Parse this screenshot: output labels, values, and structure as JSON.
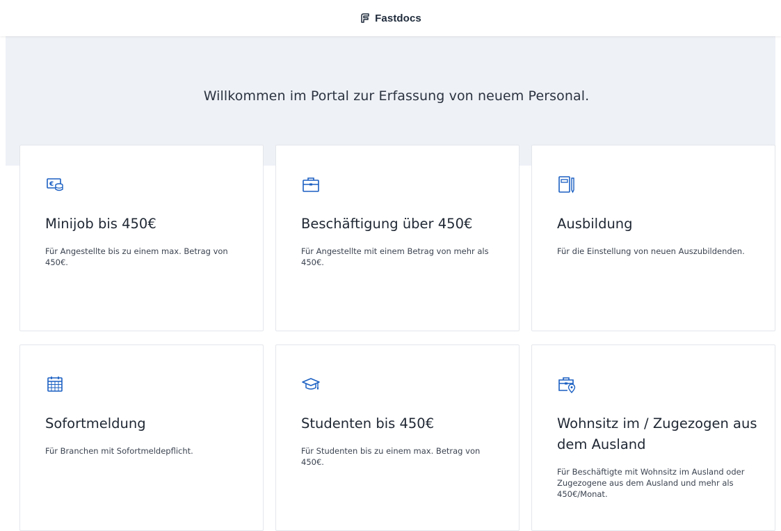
{
  "header": {
    "brand_name": "Fastdocs",
    "brand_icon": "fastdocs-logo-icon"
  },
  "hero": {
    "welcome_text": "Willkommen im Portal zur Erfassung von neuem Personal."
  },
  "colors": {
    "accent": "#1a5fc2",
    "hero_background": "#eef1f6",
    "card_border": "#e3e6eb"
  },
  "cards": [
    {
      "icon": "euro-coins-icon",
      "title": "Minijob bis 450€",
      "description": "Für Angestellte bis zu einem max. Betrag von 450€."
    },
    {
      "icon": "briefcase-icon",
      "title": "Beschäftigung über 450€",
      "description": "Für Angestellte mit einem Betrag von mehr als 450€."
    },
    {
      "icon": "notebook-pen-icon",
      "title": "Ausbildung",
      "description": "Für die Einstellung von neuen Auszubildenden."
    },
    {
      "icon": "calendar-icon",
      "title": "Sofortmeldung",
      "description": "Für Branchen mit Sofortmeldepflicht."
    },
    {
      "icon": "graduation-cap-icon",
      "title": "Studenten bis 450€",
      "description": "Für Studenten bis zu einem max. Betrag von 450€."
    },
    {
      "icon": "briefcase-location-icon",
      "title": "Wohnsitz im / Zugezogen aus dem Ausland",
      "description": "Für Beschäftigte mit Wohnsitz im Ausland oder Zugezogene aus dem Ausland und mehr als 450€/Monat."
    }
  ]
}
